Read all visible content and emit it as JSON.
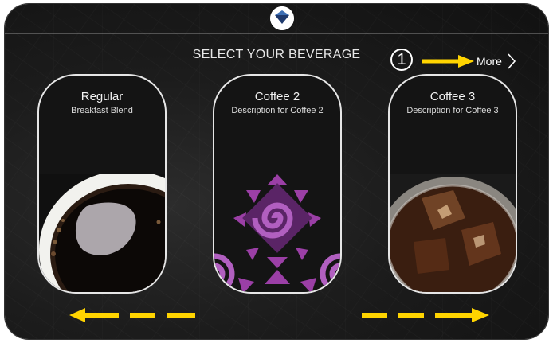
{
  "header": {
    "title": "SELECT YOUR BEVERAGE"
  },
  "annotation": {
    "step": "1"
  },
  "navigation": {
    "more_label": "More"
  },
  "beverages": [
    {
      "name": "Regular",
      "description": "Breakfast Blend",
      "image": "hot-black-coffee"
    },
    {
      "name": "Coffee 2",
      "description": "Description for Coffee 2",
      "image": "purple-pattern-placeholder"
    },
    {
      "name": "Coffee 3",
      "description": "Description for Coffee 3",
      "image": "iced-coffee"
    }
  ],
  "colors": {
    "background": "#1c1c1c",
    "accent_arrow": "#ffd400",
    "pattern_purple": "#9b3fa6",
    "card_border": "#e6e6e6",
    "logo_blue": "#1f3a6e"
  }
}
